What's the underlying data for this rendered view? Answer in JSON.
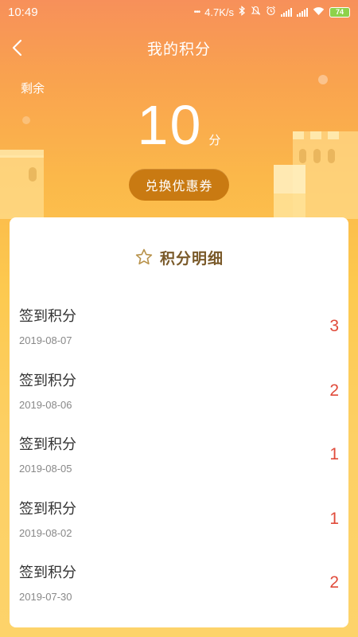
{
  "status_bar": {
    "time": "10:49",
    "network_speed": "4.7K/s",
    "battery": "74",
    "icons": [
      "dots-icon",
      "bluetooth-icon",
      "mute-icon",
      "alarm-icon",
      "signal-icon",
      "signal-icon",
      "wifi-icon",
      "battery-icon"
    ]
  },
  "header": {
    "title": "我的积分",
    "back_icon": "chevron-left-icon"
  },
  "summary": {
    "remaining_label": "剩余",
    "points": "10",
    "unit": "分",
    "redeem_button": "兑换优惠券"
  },
  "details": {
    "title": "积分明细",
    "title_icon": "star-outline-icon",
    "records": [
      {
        "title": "签到积分",
        "date": "2019-08-07",
        "points": "3"
      },
      {
        "title": "签到积分",
        "date": "2019-08-06",
        "points": "2"
      },
      {
        "title": "签到积分",
        "date": "2019-08-05",
        "points": "1"
      },
      {
        "title": "签到积分",
        "date": "2019-08-02",
        "points": "1"
      },
      {
        "title": "签到积分",
        "date": "2019-07-30",
        "points": "2"
      }
    ]
  },
  "colors": {
    "accent": "#c97a12",
    "points_red": "#e04b3b",
    "title_brown": "#7a5a2a"
  }
}
